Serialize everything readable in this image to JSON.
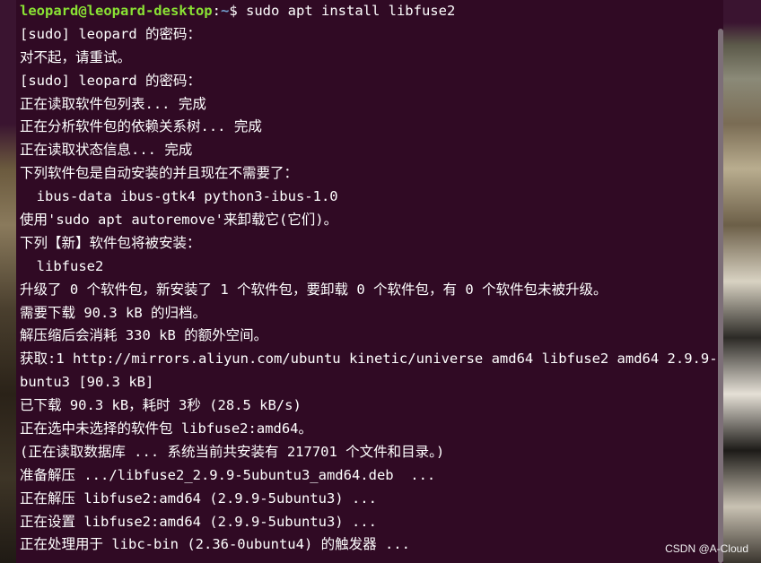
{
  "terminal": {
    "prompt": {
      "user_host": "leopard@leopard-desktop",
      "separator": ":",
      "path": "~",
      "symbol": "$",
      "command": " sudo apt install libfuse2"
    },
    "lines": [
      "[sudo] leopard 的密码：",
      "对不起，请重试。",
      "[sudo] leopard 的密码：",
      "正在读取软件包列表... 完成",
      "正在分析软件包的依赖关系树... 完成",
      "正在读取状态信息... 完成",
      "下列软件包是自动安装的并且现在不需要了：",
      "  ibus-data ibus-gtk4 python3-ibus-1.0",
      "使用'sudo apt autoremove'来卸载它(它们)。",
      "下列【新】软件包将被安装：",
      "  libfuse2",
      "升级了 0 个软件包，新安装了 1 个软件包，要卸载 0 个软件包，有 0 个软件包未被升级。",
      "需要下载 90.3 kB 的归档。",
      "解压缩后会消耗 330 kB 的额外空间。",
      "获取:1 http://mirrors.aliyun.com/ubuntu kinetic/universe amd64 libfuse2 amd64 2.9.9-5u",
      "buntu3 [90.3 kB]",
      "已下载 90.3 kB，耗时 3秒 (28.5 kB/s)",
      "正在选中未选择的软件包 libfuse2:amd64。",
      "(正在读取数据库 ... 系统当前共安装有 217701 个文件和目录。)",
      "准备解压 .../libfuse2_2.9.9-5ubuntu3_amd64.deb  ...",
      "正在解压 libfuse2:amd64 (2.9.9-5ubuntu3) ...",
      "正在设置 libfuse2:amd64 (2.9.9-5ubuntu3) ...",
      "正在处理用于 libc-bin (2.36-0ubuntu4) 的触发器 ..."
    ]
  },
  "watermark": "CSDN @A-Cloud"
}
